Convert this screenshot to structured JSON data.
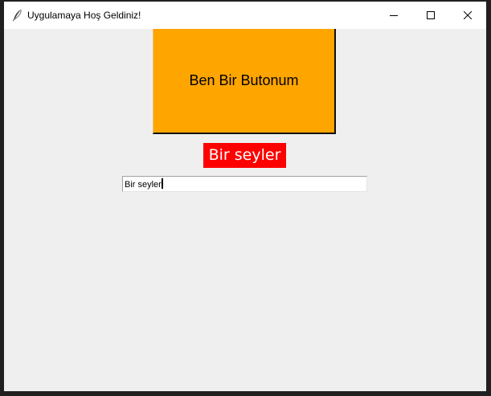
{
  "window": {
    "title": "Uygulamaya Hoş Geldiniz!",
    "icon": "feather-icon",
    "controls": [
      "minimize-icon",
      "maximize-icon",
      "close-icon"
    ]
  },
  "main": {
    "button_label": "Ben Bir Butonum",
    "label_text": "Bir seyler",
    "entry_value": "Bir seyler"
  },
  "colors": {
    "button_bg": "#ffa500",
    "label_bg": "#ff0000",
    "label_fg": "#ffffff",
    "window_bg": "#efefef"
  }
}
